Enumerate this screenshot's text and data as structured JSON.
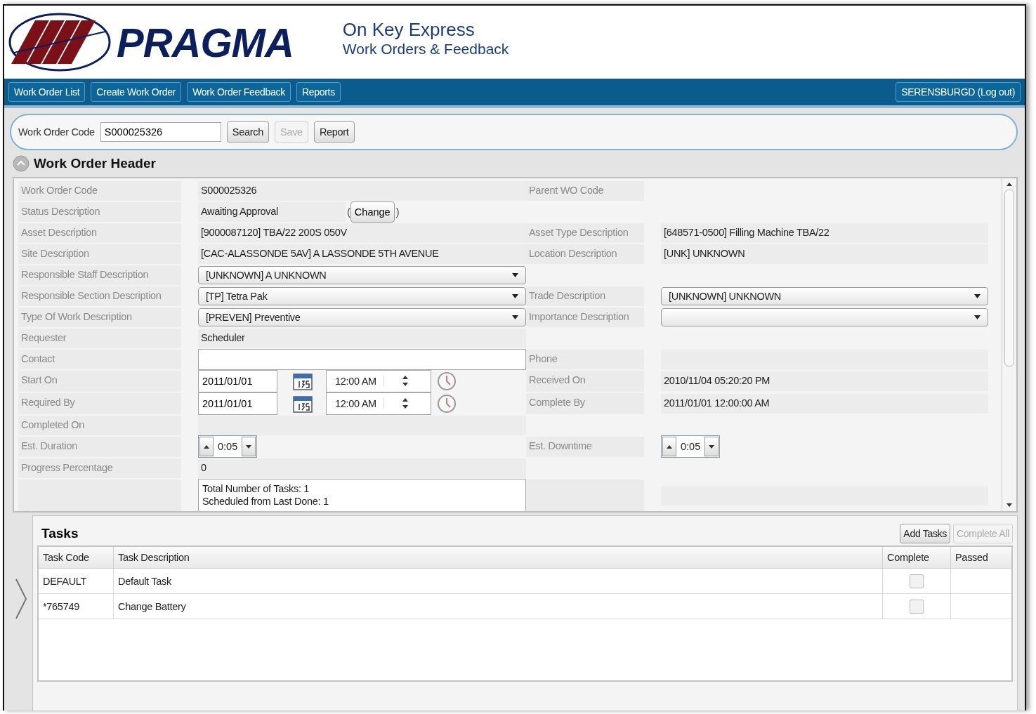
{
  "header": {
    "brand": "PRAGMA",
    "title": "On Key Express",
    "subtitle": "Work Orders & Feedback"
  },
  "nav": {
    "items": [
      "Work Order List",
      "Create Work Order",
      "Work Order Feedback",
      "Reports"
    ],
    "user": "SERENSBURGD (Log out)"
  },
  "search": {
    "label": "Work Order Code",
    "value": "S000025326",
    "buttons": [
      {
        "label": "Search",
        "disabled": false
      },
      {
        "label": "Save",
        "disabled": true
      },
      {
        "label": "Report",
        "disabled": false
      }
    ]
  },
  "section": {
    "title": "Work Order Header",
    "expanded": true
  },
  "form": [
    {
      "left": {
        "label": "Work Order Code",
        "kind": "text",
        "value": "S000025326"
      },
      "right": {
        "label": "Parent WO Code",
        "kind": "none"
      }
    },
    {
      "left": {
        "label": "Status Description",
        "kind": "status",
        "value": "Awaiting Approval",
        "open": "(",
        "button": "Change",
        "close": ")"
      }
    },
    {
      "left": {
        "label": "Asset Description",
        "kind": "text",
        "value": "[9000087120] TBA/22 200S 050V"
      },
      "right": {
        "label": "Asset Type Description",
        "kind": "text",
        "value": "[648571-0500] Filling Machine TBA/22"
      }
    },
    {
      "left": {
        "label": "Site Description",
        "kind": "text",
        "value": "[CAC-ALASSONDE 5AV] A LASSONDE 5TH AVENUE"
      },
      "right": {
        "label": "Location Description",
        "kind": "text",
        "value": "[UNK] UNKNOWN"
      }
    },
    {
      "left": {
        "label": "Responsible Staff Description",
        "kind": "select",
        "value": "[UNKNOWN] A UNKNOWN"
      }
    },
    {
      "left": {
        "label": "Responsible Section Description",
        "kind": "select",
        "value": "[TP] Tetra Pak"
      },
      "right": {
        "label": "Trade Description",
        "kind": "select",
        "value": "[UNKNOWN] UNKNOWN"
      }
    },
    {
      "left": {
        "label": "Type Of Work Description",
        "kind": "select",
        "value": "[PREVEN] Preventive"
      },
      "right": {
        "label": "Importance Description",
        "kind": "select"
      }
    },
    {
      "left": {
        "label": "Requester",
        "kind": "text",
        "value": "Scheduler"
      }
    },
    {
      "left": {
        "label": "Contact",
        "kind": "input"
      },
      "right": {
        "label": "Phone",
        "kind": "text"
      }
    },
    {
      "left": {
        "label": "Start On",
        "kind": "datetime",
        "value": "2011/01/01",
        "time": "12:00 AM"
      },
      "right": {
        "label": "Received On",
        "kind": "text",
        "value": "2010/11/04 05:20:20 PM"
      }
    },
    {
      "left": {
        "label": "Required By",
        "kind": "datetime",
        "value": "2011/01/01",
        "time": "12:00 AM"
      },
      "right": {
        "label": "Complete By",
        "kind": "text",
        "value": "2011/01/01 12:00:00 AM"
      }
    },
    {
      "left": {
        "label": "Completed On",
        "kind": "text"
      }
    },
    {
      "left": {
        "label": "Est. Duration",
        "kind": "spinner",
        "value": "0:05"
      },
      "right": {
        "label": "Est. Downtime",
        "kind": "spinner",
        "value": "0:05"
      }
    },
    {
      "left": {
        "label": "Progress Percentage",
        "kind": "text",
        "value": "0"
      }
    },
    {
      "left": {
        "kind": "note",
        "lines": [
          "Total Number of Tasks: 1",
          "Scheduled from Last Done: 1"
        ]
      },
      "right": {
        "kind": "text"
      }
    }
  ],
  "tasks": {
    "title": "Tasks",
    "buttons": [
      {
        "label": "Add Tasks",
        "disabled": false
      },
      {
        "label": "Complete All",
        "disabled": true
      }
    ],
    "columns": [
      "Task Code",
      "Task Description",
      "Complete",
      "Passed"
    ],
    "rows": [
      {
        "code": "DEFAULT",
        "description": "Default Task",
        "complete": false
      },
      {
        "code": "*765749",
        "description": "Change Battery",
        "complete": false
      }
    ]
  }
}
